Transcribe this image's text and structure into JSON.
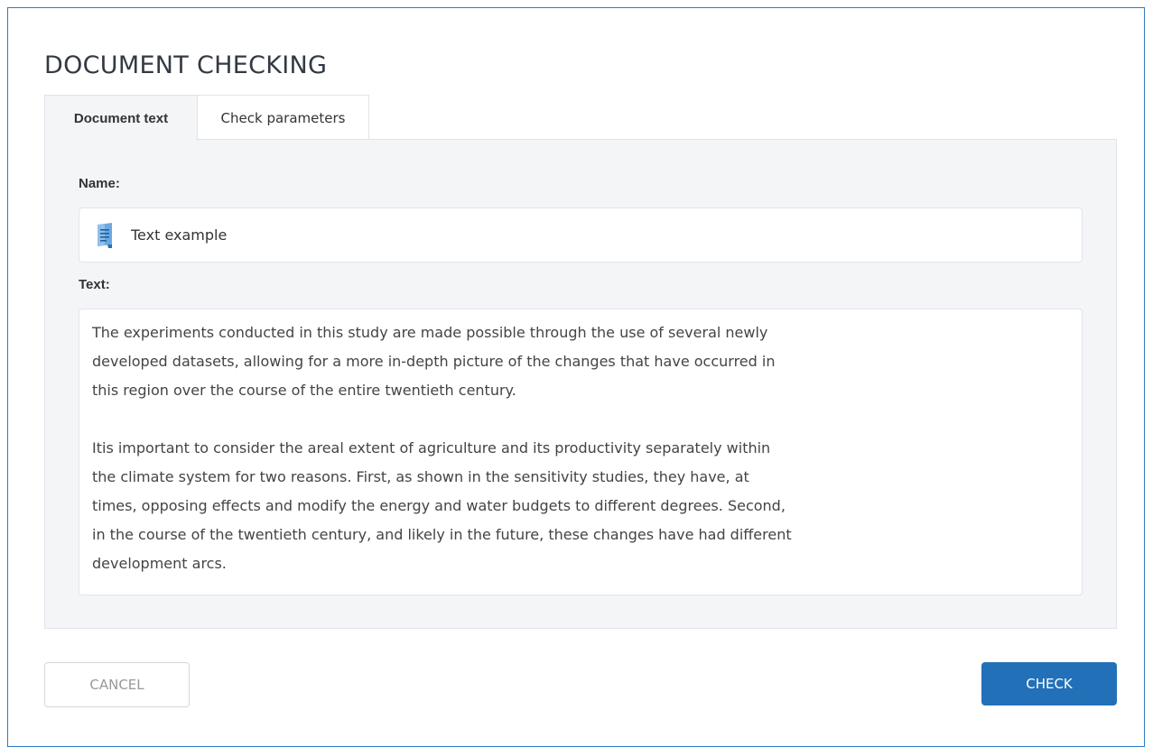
{
  "page": {
    "title": "DOCUMENT CHECKING"
  },
  "tabs": [
    {
      "label": "Document text",
      "active": true
    },
    {
      "label": "Check parameters",
      "active": false
    }
  ],
  "form": {
    "name_label": "Name:",
    "name_value": "Text example",
    "name_icon": "document-icon",
    "text_label": "Text:",
    "text_paragraphs": [
      "The experiments conducted in this study are made possible through the use of several newly developed datasets, allowing for a more in-depth picture of the changes that have occurred in this region over the course of the entire twentieth century.",
      "Itis important to consider the areal extent of agriculture and its productivity separately within the climate system for two reasons. First, as shown in the sensitivity studies, they have, at times, opposing effects and modify the energy and water budgets to different degrees. Second, in the course of the twentieth century, and likely in the future, these changes have had different development arcs."
    ]
  },
  "actions": {
    "cancel_label": "CANCEL",
    "check_label": "CHECK"
  },
  "colors": {
    "accent": "#2270b8",
    "window_border": "#2e7bc4",
    "panel_background": "#f3f5f7"
  }
}
